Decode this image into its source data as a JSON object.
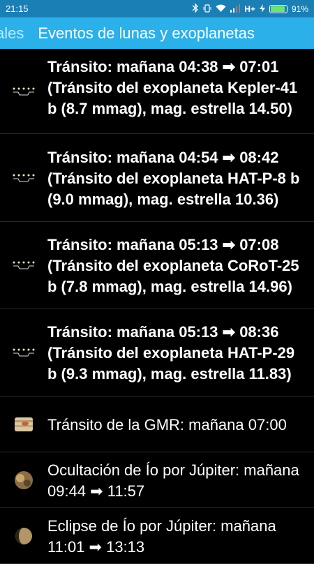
{
  "status_bar": {
    "time": "21:15",
    "network": "H+",
    "battery_percent": "91%",
    "battery_level": 0.91,
    "icons": [
      "bluetooth-icon",
      "vibrate-icon",
      "wifi-icon",
      "signal-icon",
      "charging-icon"
    ]
  },
  "app_bar": {
    "previous_title": "ales",
    "title": "Eventos de lunas y exoplanetas",
    "background": "#2bb0ea"
  },
  "events": [
    {
      "text": "Tránsito: mañana 04:38 ➡ 07:01 (Tránsito del exoplaneta Kepler-41 b (8.7 mmag), mag. estrella 14.50)",
      "icon": "exoplanet-transit-icon"
    },
    {
      "text": "Tránsito: mañana 04:54 ➡ 08:42 (Tránsito del exoplaneta HAT-P-8 b (9.0 mmag), mag. estrella 10.36)",
      "icon": "exoplanet-transit-icon"
    },
    {
      "text": "Tránsito: mañana 05:13 ➡ 07:08 (Tránsito del exoplaneta CoRoT-25 b (7.8 mmag), mag. estrella 14.96)",
      "icon": "exoplanet-transit-icon"
    },
    {
      "text": "Tránsito: mañana 05:13 ➡ 08:36 (Tránsito del exoplaneta HAT-P-29 b (9.3 mmag), mag. estrella 11.83)",
      "icon": "exoplanet-transit-icon"
    },
    {
      "text": "Tránsito de la GMR: mañana 07:00",
      "icon": "great-red-spot-icon"
    },
    {
      "text": "Ocultación de Ío por Júpiter: mañana 09:44 ➡  11:57",
      "icon": "jupiter-io-occultation-icon"
    },
    {
      "text": "Eclipse de Ío por Júpiter: mañana 11:01 ➡  13:13",
      "icon": "io-eclipse-icon"
    }
  ]
}
